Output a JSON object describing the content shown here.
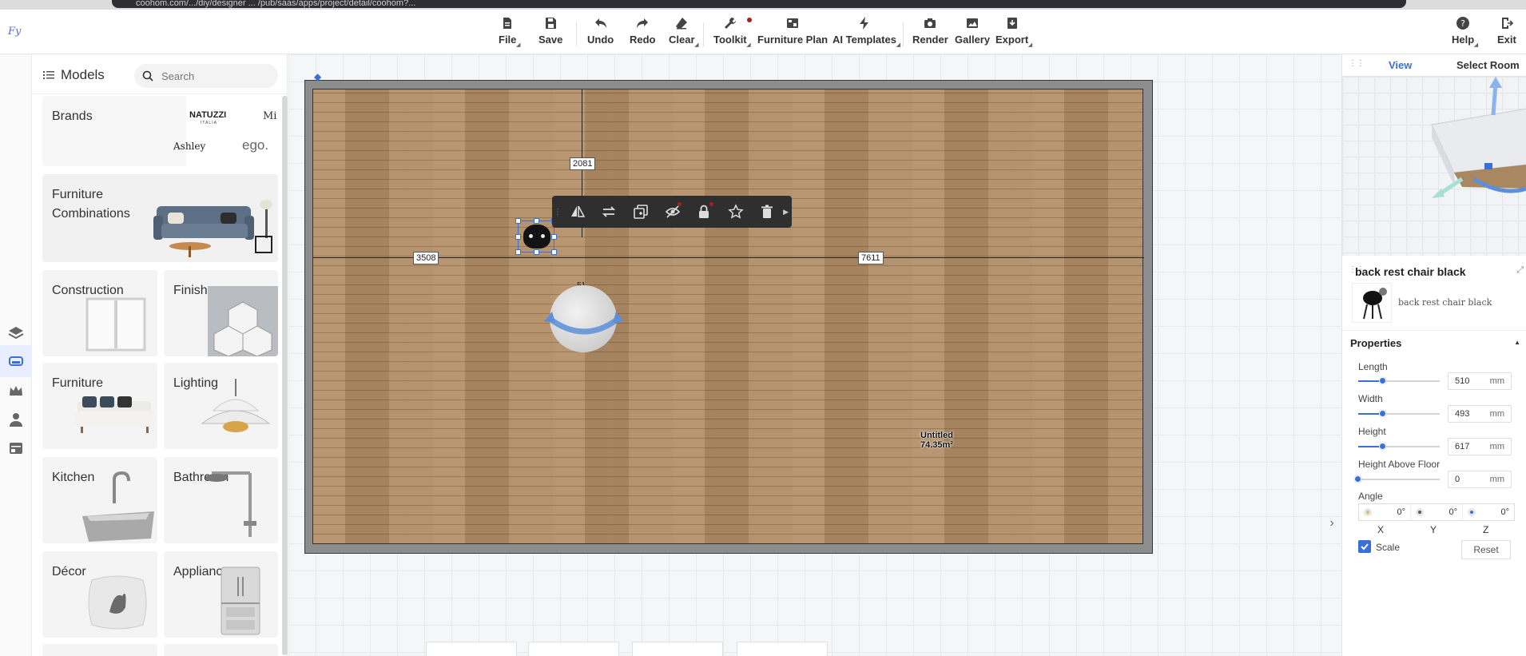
{
  "browser": {
    "url": "coohom.com/.../diy/designer ... /pub/saas/apps/project/detail/coohom?..."
  },
  "app": {
    "logo": "Fy"
  },
  "toolbar": {
    "file": "File",
    "save": "Save",
    "undo": "Undo",
    "redo": "Redo",
    "clear": "Clear",
    "toolkit": "Toolkit",
    "furniture_plan": "Furniture Plan",
    "ai_templates": "AI Templates",
    "render": "Render",
    "gallery": "Gallery",
    "export": "Export",
    "help": "Help",
    "exit": "Exit"
  },
  "models": {
    "title": "Models",
    "search_placeholder": "Search",
    "brands": {
      "title": "Brands",
      "logos": [
        "NATUZZI",
        "ITALIA",
        "Mi",
        "Ashley",
        "ego."
      ]
    },
    "categories": [
      {
        "label": "Furniture Combinations"
      },
      {
        "label": "Construction"
      },
      {
        "label": "Finishes"
      },
      {
        "label": "Furniture"
      },
      {
        "label": "Lighting"
      },
      {
        "label": "Kitchen"
      },
      {
        "label": "Bathroom"
      },
      {
        "label": "Décor"
      },
      {
        "label": "Appliances"
      }
    ]
  },
  "canvas": {
    "dimensions": {
      "top": "2081",
      "left": "3508",
      "right": "7611",
      "below": "51"
    },
    "room": {
      "name": "Untitled",
      "area": "74.35m²"
    }
  },
  "right_panel": {
    "tabs": [
      "View",
      "Select Room"
    ],
    "object": {
      "title": "back rest chair black",
      "name": "back rest chair black"
    },
    "properties": {
      "title": "Properties",
      "length": {
        "label": "Length",
        "value": "510",
        "unit": "mm",
        "level": 0.3
      },
      "width": {
        "label": "Width",
        "value": "493",
        "unit": "mm",
        "level": 0.3
      },
      "height": {
        "label": "Height",
        "value": "617",
        "unit": "mm",
        "level": 0.3
      },
      "height_above_floor": {
        "label": "Height Above Floor",
        "value": "0",
        "unit": "mm",
        "level": 0.0
      },
      "angle": {
        "label": "Angle",
        "x": "0°",
        "y": "0°",
        "z": "0°",
        "axis_x": "X",
        "axis_y": "Y",
        "axis_z": "Z"
      },
      "scale_label": "Scale",
      "scale_checked": true,
      "reset_label": "Reset"
    }
  },
  "colors": {
    "accent": "#3b6fd8",
    "floor": "#b08c66",
    "wall": "#8d8d8d",
    "toolbar_dark": "#2f2f2f",
    "dot": "#a3231a"
  }
}
